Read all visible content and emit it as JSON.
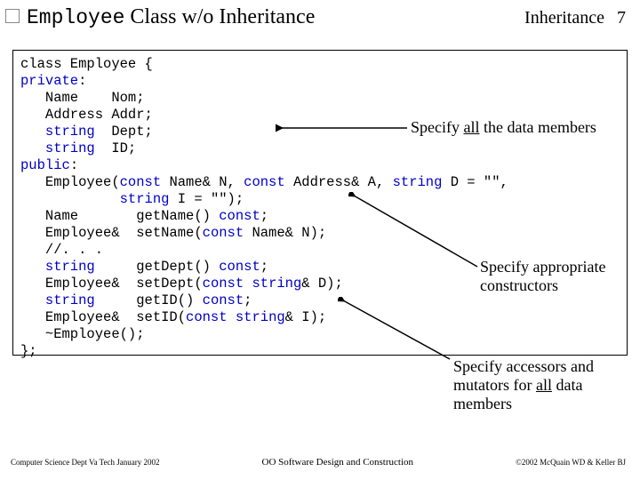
{
  "header": {
    "title_code": "Employee",
    "title_rest": " Class w/o Inheritance",
    "topic": "Inheritance",
    "page": "7"
  },
  "code": {
    "l1a": "class Employee {",
    "l2a": "private",
    "l2b": ":",
    "l3a": "   Name    Nom;",
    "l4a": "   Address Addr;",
    "l5a": "   ",
    "l5b": "string",
    "l5c": "  Dept;",
    "l6a": "   ",
    "l6b": "string",
    "l6c": "  ID;",
    "l7a": "public",
    "l7b": ":",
    "l8a": "   Employee(",
    "l8b": "const",
    "l8c": " Name& N, ",
    "l8d": "const",
    "l8e": " Address& A, ",
    "l8f": "string",
    "l8g": " D = \"\",",
    "l9a": "            ",
    "l9b": "string",
    "l9c": " I = \"\");",
    "l10a": "   Name       getName() ",
    "l10b": "const",
    "l10c": ";",
    "l11a": "   Employee&  setName(",
    "l11b": "const",
    "l11c": " Name& N);",
    "l12a": "   //. . .",
    "l13a": "   ",
    "l13b": "string",
    "l13c": "     getDept() ",
    "l13d": "const",
    "l13e": ";",
    "l14a": "   Employee&  setDept(",
    "l14b": "const",
    "l14c": " ",
    "l14d": "string",
    "l14e": "& D);",
    "l15a": "   ",
    "l15b": "string",
    "l15c": "     getID() ",
    "l15d": "const",
    "l15e": ";",
    "l16a": "   Employee&  setID(",
    "l16b": "const",
    "l16c": " ",
    "l16d": "string",
    "l16e": "& I);",
    "l17a": "   ~Employee();",
    "l18a": "};"
  },
  "annotations": {
    "a1_pre": "Specify ",
    "a1_u": "all",
    "a1_post": " the data members",
    "a2_l1": "Specify appropriate",
    "a2_l2": "constructors",
    "a3_l1_pre": "Specify accessors and",
    "a3_l2_pre": "mutators for ",
    "a3_l2_u": "all",
    "a3_l2_post": " data",
    "a3_l3": "members"
  },
  "footer": {
    "left": "Computer Science Dept Va Tech January 2002",
    "mid": "OO Software Design and Construction",
    "right": "©2002 McQuain WD & Keller BJ"
  }
}
